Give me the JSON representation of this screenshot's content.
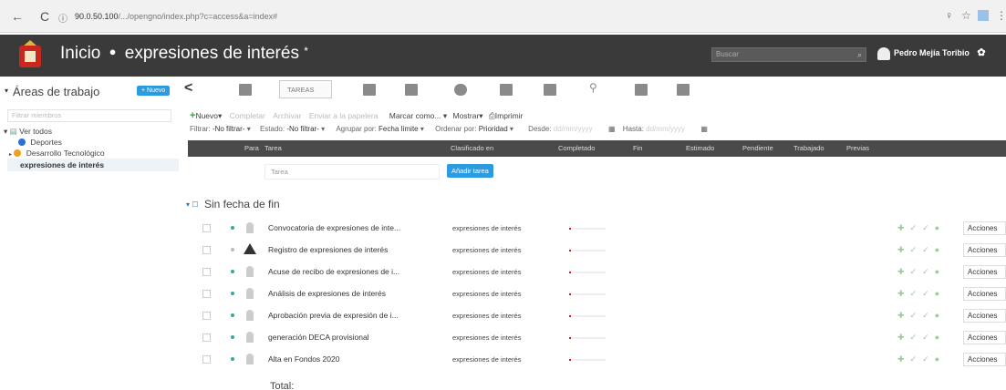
{
  "browser": {
    "url_host": "90.0.50.100",
    "url_rest": "/.../opengno/index.php?c=access&a=index#"
  },
  "header": {
    "inicio": "Inicio",
    "workspace": "expresiones de interés",
    "workspace_suffix": "*",
    "search_placeholder": "Buscar",
    "user_name": "Pedro Mejía Toribio"
  },
  "sidebar": {
    "title": "Áreas de trabajo",
    "new_button": "+ Nuevo",
    "filter_placeholder": "Filtrar miembros",
    "tree": [
      {
        "label": "Ver todos",
        "color": ""
      },
      {
        "label": "Deportes",
        "color": "#2a6fd4"
      },
      {
        "label": "Desarrollo Tecnológico",
        "color": "#f0a020"
      },
      {
        "label": "expresiones de interés",
        "color": ""
      }
    ]
  },
  "tabs": {
    "active": "TAREAS"
  },
  "toolbar": {
    "new": "Nuevo",
    "complete": "Completar",
    "archive": "Archivar",
    "move_trash": "Enviar a la papelera",
    "mark_as": "Marcar como...",
    "show": "Mostrar",
    "print": "Imprimir"
  },
  "filters": {
    "filter_label": "Filtrar:",
    "filter_value": "-No filtrar-",
    "state_label": "Estado:",
    "state_value": "-No filtrar-",
    "group_label": "Agrupar por:",
    "group_value": "Fecha límite",
    "order_label": "Ordenar por:",
    "order_value": "Prioridad",
    "from_label": "Desde:",
    "from_placeholder": "dd/mm/yyyy",
    "to_label": "Hasta:",
    "to_placeholder": "dd/mm/yyyy"
  },
  "table": {
    "columns": [
      "Para",
      "Tarea",
      "Clasificado en",
      "Completado",
      "Fin",
      "Estimado",
      "Pendiente",
      "Trabajado",
      "Previas"
    ],
    "new_task_placeholder": "Tarea",
    "add_task_button": "Añadir tarea",
    "group_title": "Sin fecha de fin",
    "rows": [
      {
        "name": "Convocatoria de expresiones de inte...",
        "classified": "expresiones de interés",
        "warn": false
      },
      {
        "name": "Registro de expresiones de interés",
        "classified": "expresiones de interés",
        "warn": true
      },
      {
        "name": "Acuse de recibo de expresiones de i...",
        "classified": "expresiones de interés",
        "warn": false
      },
      {
        "name": "Análisis de expresiones de interés",
        "classified": "expresiones de interés",
        "warn": false
      },
      {
        "name": "Aprobación previa de expresión de i...",
        "classified": "expresiones de interés",
        "warn": false
      },
      {
        "name": "generación DECA provisional",
        "classified": "expresiones de interés",
        "warn": false
      },
      {
        "name": "Alta en Fondos 2020",
        "classified": "expresiones de interés",
        "warn": false
      }
    ],
    "actions_label": "Acciones",
    "total_label": "Total:"
  }
}
